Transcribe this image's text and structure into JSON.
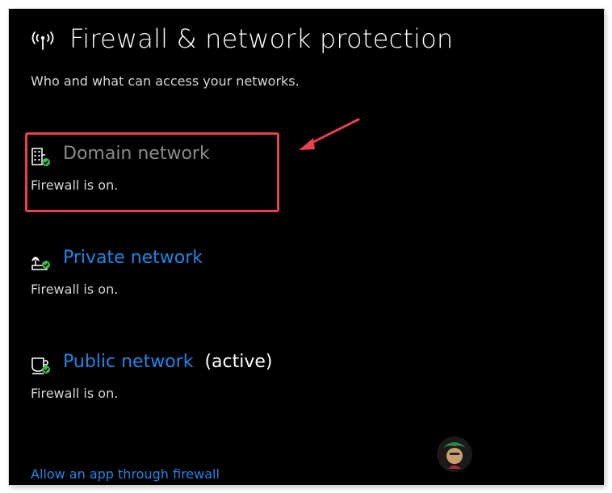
{
  "header": {
    "title": "Firewall & network protection",
    "subtitle": "Who and what can access your networks.",
    "icon": "wireless-signal-icon"
  },
  "networks": [
    {
      "name": "Domain network",
      "status": "Firewall is on.",
      "icon": "domain-building-icon",
      "state": "disabled-highlighted"
    },
    {
      "name": "Private network",
      "status": "Firewall is on.",
      "icon": "private-home-network-icon",
      "state": "link"
    },
    {
      "name": "Public network",
      "active_label": "(active)",
      "status": "Firewall is on.",
      "icon": "public-coffee-cup-icon",
      "state": "link"
    }
  ],
  "links": {
    "allow_app": "Allow an app through firewall"
  },
  "annotation": {
    "highlight_color": "#e8414b",
    "arrow_color": "#e8414b"
  },
  "colors": {
    "background": "#000000",
    "link": "#1f86e6",
    "text": "#d6d6d6",
    "check": "#3fb950"
  }
}
